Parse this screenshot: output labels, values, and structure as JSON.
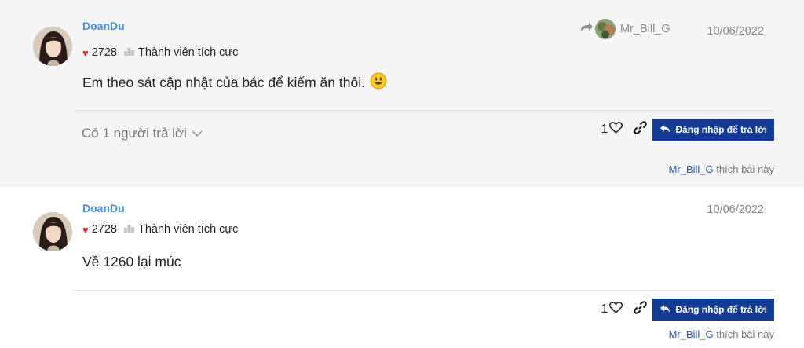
{
  "posts": [
    {
      "username": "DoanDu",
      "reputation": "2728",
      "rank": "Thành viên tích cực",
      "date": "10/06/2022",
      "reply_to_user": "Mr_Bill_G",
      "content": "Em theo sát cập nhật của bác để kiếm ăn thôi.",
      "replies_label": "Có 1 người trả lời",
      "like_count": "1",
      "reply_button_label": "Đăng nhập để trả lời",
      "liked_by_user": "Mr_Bill_G",
      "liked_by_suffix": " thích bài này"
    },
    {
      "username": "DoanDu",
      "reputation": "2728",
      "rank": "Thành viên tích cực",
      "date": "10/06/2022",
      "content": "Về 1260 lại múc",
      "like_count": "1",
      "reply_button_label": "Đăng nhập để trả lời",
      "liked_by_user": "Mr_Bill_G",
      "liked_by_suffix": " thích bài này"
    }
  ],
  "icons": {
    "heart": "heart-icon",
    "rank": "rank-icon",
    "smiley": "smiley-icon",
    "reply_arrow": "reply-arrow-icon",
    "chevron": "chevron-down-icon",
    "like": "like-icon",
    "link": "link-icon",
    "reply": "reply-button-icon"
  },
  "colors": {
    "username": "#4a8fe0",
    "heart": "#e0242e",
    "reply_button_bg": "#123b93",
    "liked_by_user": "#2a55b5",
    "post_bg_alt": "#f5f5f5"
  }
}
